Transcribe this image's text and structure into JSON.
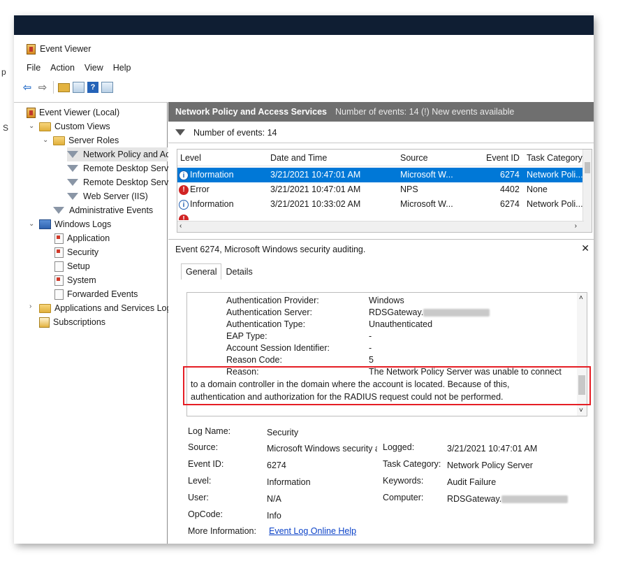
{
  "window": {
    "title": "Event Viewer"
  },
  "menu": [
    "File",
    "Action",
    "View",
    "Help"
  ],
  "tree": {
    "root": "Event Viewer (Local)",
    "custom_views": "Custom Views",
    "server_roles": "Server Roles",
    "npas": "Network Policy and Ac",
    "rds1": "Remote Desktop Serv",
    "rds2": "Remote Desktop Serv",
    "iis": "Web Server (IIS)",
    "admin_events": "Administrative Events",
    "windows_logs": "Windows Logs",
    "application": "Application",
    "security": "Security",
    "setup": "Setup",
    "system": "System",
    "forwarded": "Forwarded Events",
    "apps_services": "Applications and Services Log",
    "subscriptions": "Subscriptions"
  },
  "header": {
    "title": "Network Policy and Access Services",
    "subtitle": "Number of events: 14 (!) New events available"
  },
  "filter": {
    "label": "Number of events: 14"
  },
  "grid": {
    "columns": [
      "Level",
      "Date and Time",
      "Source",
      "Event ID",
      "Task Category"
    ],
    "rows": [
      {
        "level": "Information",
        "date": "3/21/2021 10:47:01 AM",
        "source": "Microsoft W...",
        "id": "6274",
        "task": "Network Poli..."
      },
      {
        "level": "Error",
        "date": "3/21/2021 10:47:01 AM",
        "source": "NPS",
        "id": "4402",
        "task": "None"
      },
      {
        "level": "Information",
        "date": "3/21/2021 10:33:02 AM",
        "source": "Microsoft W...",
        "id": "6274",
        "task": "Network Poli..."
      }
    ]
  },
  "detail": {
    "title": "Event 6274, Microsoft Windows security auditing.",
    "tabs": [
      "General",
      "Details"
    ],
    "description": [
      {
        "k": "Authentication Provider:",
        "v": "Windows"
      },
      {
        "k": "Authentication Server:",
        "v": "RDSGateway."
      },
      {
        "k": "Authentication Type:",
        "v": "Unauthenticated"
      },
      {
        "k": "EAP Type:",
        "v": "-"
      },
      {
        "k": "Account Session Identifier:",
        "v": "-"
      },
      {
        "k": "Reason Code:",
        "v": "5"
      },
      {
        "k": "Reason:",
        "v": "The Network Policy Server was unable to connect"
      }
    ],
    "reason_line2": "to a domain controller in the domain where the account is located. Because of this,",
    "reason_line3": "authentication and authorization for the RADIUS request could not be performed.",
    "props": {
      "log_name_label": "Log Name:",
      "log_name": "Security",
      "source_label": "Source:",
      "source": "Microsoft Windows security a",
      "logged_label": "Logged:",
      "logged": "3/21/2021 10:47:01 AM",
      "event_id_label": "Event ID:",
      "event_id": "6274",
      "task_cat_label": "Task Category:",
      "task_cat": "Network Policy Server",
      "level_label": "Level:",
      "level": "Information",
      "keywords_label": "Keywords:",
      "keywords": "Audit Failure",
      "user_label": "User:",
      "user": "N/A",
      "computer_label": "Computer:",
      "computer": "RDSGateway.",
      "opcode_label": "OpCode:",
      "opcode": "Info",
      "more_info_label": "More Information:",
      "more_info_link": "Event Log Online Help"
    }
  }
}
